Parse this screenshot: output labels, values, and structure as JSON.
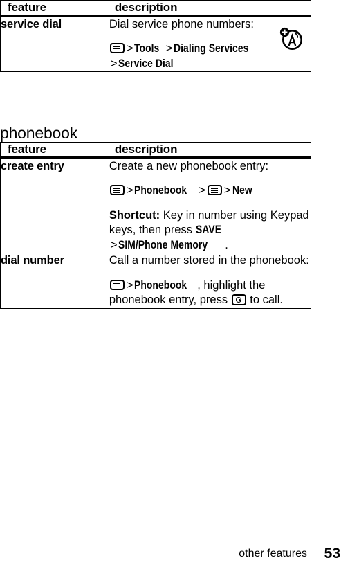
{
  "page": {
    "footer": {
      "running_head": "other features",
      "page_number": "53"
    }
  },
  "tables": [
    {
      "id": "other-features-table",
      "headers": {
        "feature": "feature",
        "description": "description"
      },
      "rows": [
        {
          "feature": "service dial",
          "description_intro": "Dial service phone numbers:",
          "path": {
            "menu_icon": "menu-key-icon",
            "sep1": ">",
            "item1": "Tools",
            "sep2": ">",
            "item2": "Dialing Services",
            "sep3": ">",
            "item3": "Service Dial"
          },
          "margin_icon": "service-dial-antenna-icon"
        }
      ]
    },
    {
      "id": "phonebook-table",
      "section_title": "phonebook",
      "headers": {
        "feature": "feature",
        "description": "description"
      },
      "rows": [
        {
          "feature": "create entry",
          "description_intro": "Create a new phonebook entry:",
          "path": {
            "menu_icon": "menu-key-icon",
            "sep1": ">",
            "item1": "Phonebook",
            "sep2": ">",
            "menu_icon_2": "menu-key-icon",
            "sep3": ">",
            "item2": "New"
          },
          "shortcut": {
            "label": "Shortcut:",
            "text_a": "Key in number using Keypad keys, then press",
            "soft_key": "SAVE",
            "sep": ">",
            "menu_item": "SIM/Phone Memory",
            "text_b": "."
          }
        },
        {
          "feature": "dial number",
          "description_intro": "Call a number stored in the phonebook:",
          "path": {
            "menu_icon": "menu-key-icon",
            "sep1": ">",
            "item1": "Phonebook",
            "text_a": ", highlight the phonebook entry, press",
            "send_icon": "send-key-icon",
            "text_b": "to call."
          }
        }
      ]
    }
  ],
  "colors": {
    "text": "#000000",
    "background": "#ffffff",
    "rule": "#000000"
  }
}
